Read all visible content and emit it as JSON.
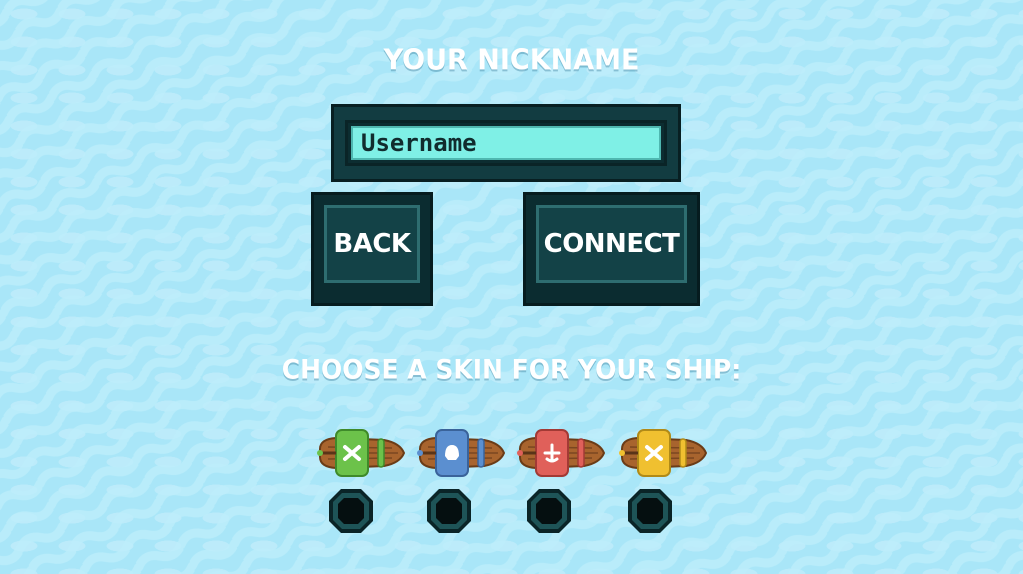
{
  "nickname": {
    "title": "YOUR NICKNAME",
    "placeholder": "Username"
  },
  "buttons": {
    "back_label": "BACK",
    "connect_label": "CONNECT"
  },
  "skins": {
    "title": "CHOOSE A SKIN FOR YOUR SHIP:",
    "options": [
      {
        "name": "green",
        "color": "#6cc24a",
        "emblem": "crossed-swords-icon"
      },
      {
        "name": "blue",
        "color": "#5b8fd0",
        "emblem": "skull-icon"
      },
      {
        "name": "red",
        "color": "#e0605a",
        "emblem": "anchor-icon"
      },
      {
        "name": "yellow",
        "color": "#f0c030",
        "emblem": "crossed-swords-icon"
      }
    ]
  },
  "colors": {
    "background": "#a9e6f8",
    "panel": "#134247",
    "input": "#7ff0e6"
  }
}
